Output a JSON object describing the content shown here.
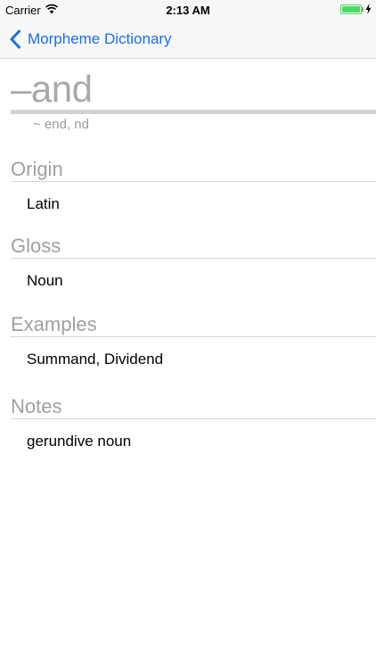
{
  "status_bar": {
    "carrier": "Carrier",
    "time": "2:13 AM",
    "wifi_icon": "wifi-icon",
    "battery_icon": "battery-charging-icon",
    "battery_color": "#4cd964"
  },
  "nav": {
    "back_label": "Morpheme Dictionary",
    "back_icon": "chevron-left-icon",
    "accent_color": "#1a6ee6"
  },
  "entry": {
    "morpheme": "–and",
    "variants": "~ end, nd",
    "sections": [
      {
        "header": "Origin",
        "value": "Latin"
      },
      {
        "header": "Gloss",
        "value": "Noun"
      },
      {
        "header": "Examples",
        "value": "Summand, Dividend"
      },
      {
        "header": "Notes",
        "value": "gerundive noun"
      }
    ]
  }
}
